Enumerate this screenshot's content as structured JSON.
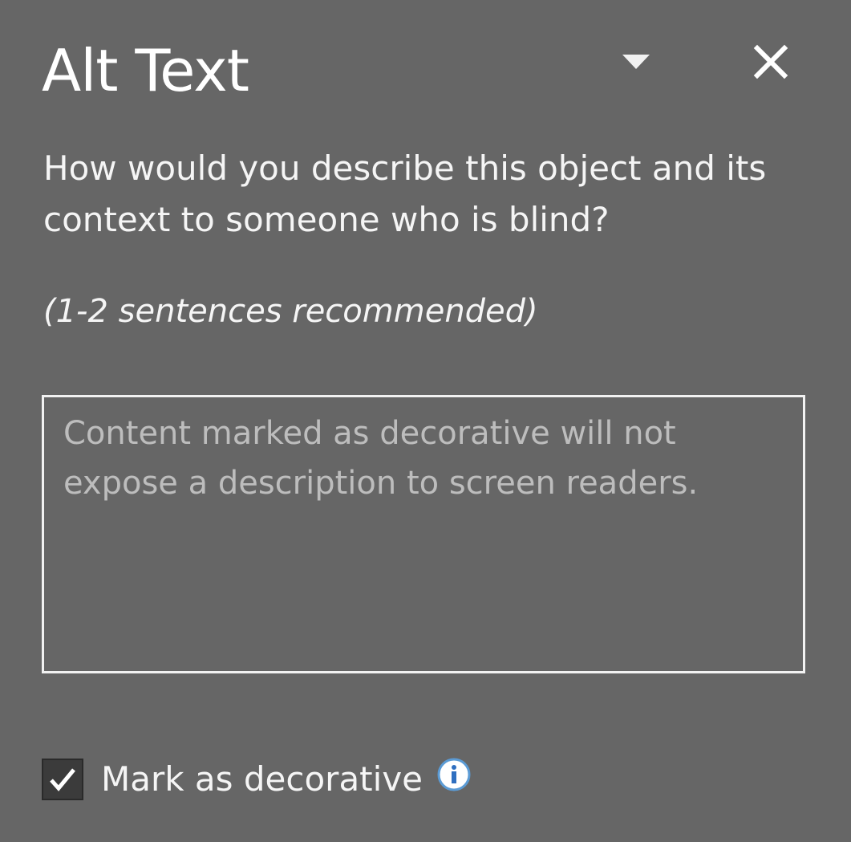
{
  "pane": {
    "title": "Alt Text",
    "options_icon": "triangle-down-icon",
    "close_icon": "close-icon"
  },
  "prompt": {
    "question": "How would you describe this object and its context to someone who is blind?",
    "hint": "(1-2 sentences recommended)"
  },
  "description_field": {
    "value": "",
    "placeholder": "Content marked as decorative will not expose a description to screen readers."
  },
  "decorative": {
    "checked": true,
    "label": "Mark as decorative",
    "info_icon": "info-icon"
  },
  "colors": {
    "background": "#666666",
    "text": "#f5f5f5",
    "placeholder": "#bdbdbd",
    "info_accent": "#5b9bd5"
  }
}
